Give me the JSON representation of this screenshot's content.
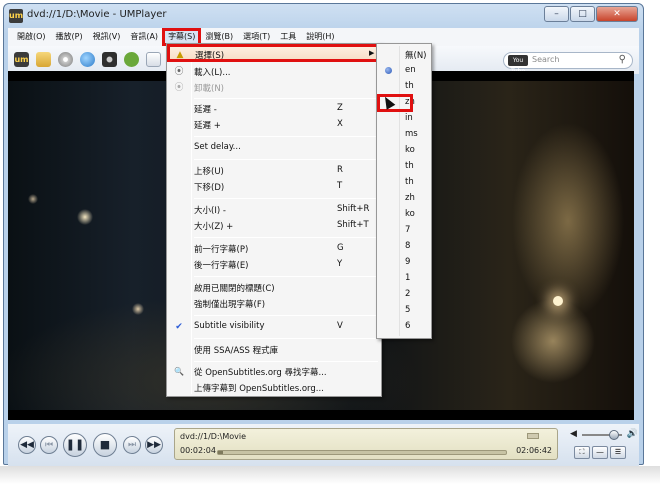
{
  "window": {
    "title": "dvd://1/D:\\Movie - UMPlayer",
    "app_icon": "um",
    "minimize": "–",
    "maximize": "□",
    "close": "✕"
  },
  "menubar": {
    "items": [
      "開啟(O)",
      "播放(P)",
      "視訊(V)",
      "音訊(A)",
      "字幕(S)",
      "瀏覽(B)",
      "選項(T)",
      "工具",
      "說明(H)"
    ]
  },
  "toolbar": {
    "search_badge": "You Tube",
    "search_placeholder": "Search",
    "search_icon": "⚲"
  },
  "subtitle_menu": {
    "items": [
      {
        "label": "選擇(S)",
        "icon": "warning-icon",
        "glyph": "▲",
        "submenu": true
      },
      {
        "label": "載入(L)...",
        "icon": "load-icon",
        "glyph": "⦿"
      },
      {
        "label": "卸載(N)",
        "icon": "unload-icon",
        "glyph": "⦿",
        "disabled": true
      },
      {
        "label": "延遲 -",
        "shortcut": "Z"
      },
      {
        "label": "延遲 +",
        "shortcut": "X"
      },
      {
        "label": "Set delay..."
      },
      {
        "label": "上移(U)",
        "shortcut": "R"
      },
      {
        "label": "下移(D)",
        "shortcut": "T"
      },
      {
        "label": "大小(I) -",
        "shortcut": "Shift+R"
      },
      {
        "label": "大小(Z) +",
        "shortcut": "Shift+T"
      },
      {
        "label": "前一行字幕(P)",
        "shortcut": "G"
      },
      {
        "label": "後一行字幕(E)",
        "shortcut": "Y"
      },
      {
        "label": "啟用已關閉的標題(C)"
      },
      {
        "label": "強制僅出現字幕(F)"
      },
      {
        "label": "Subtitle visibility",
        "shortcut": "V",
        "check": "✔"
      },
      {
        "label": "使用 SSA/ASS 程式庫"
      },
      {
        "label": "從 OpenSubtitles.org 尋找字幕...",
        "icon": "search-icon",
        "glyph": "🔍"
      },
      {
        "label": "上傳字幕到 OpenSubtitles.org..."
      }
    ],
    "submenu_arrow": "▶"
  },
  "track_menu": {
    "items": [
      "無(N)",
      "en",
      "th",
      "zh",
      "in",
      "ms",
      "ko",
      "th",
      "th",
      "zh",
      "ko",
      "7",
      "8",
      "9",
      "1",
      "2",
      "5",
      "6"
    ],
    "selected_index": 1
  },
  "controls": {
    "rewind": "◀◀",
    "prev": "⏮",
    "pause": "❚❚",
    "stop": "■",
    "next": "⏭",
    "forward": "▶▶",
    "path": "dvd://1/D:\\Movie",
    "current_time": "00:02:04",
    "total_time": "02:06:42",
    "progress": 0.016,
    "volume": 0.8,
    "speaker_icon": "🔊",
    "mute_icon": "◀",
    "fullscreen": "⛶",
    "compact": "―",
    "menu": "☰"
  }
}
